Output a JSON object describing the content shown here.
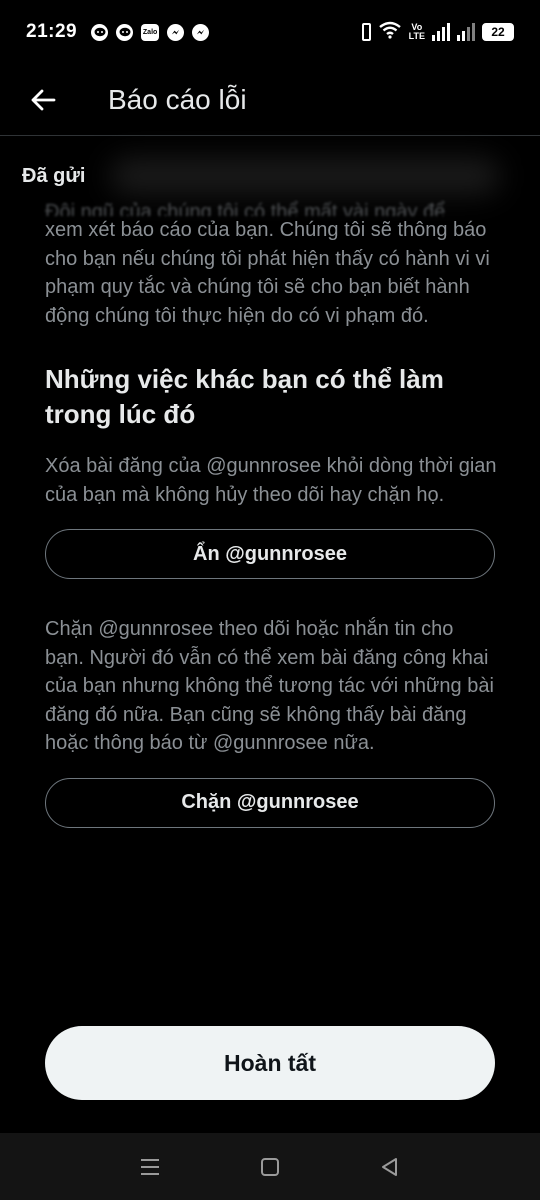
{
  "status_bar": {
    "time": "21:29",
    "notification_icons": [
      "discord-icon",
      "discord-icon",
      "zalo-icon",
      "messenger-icon",
      "messenger-icon"
    ],
    "zalo_text": "Zalo",
    "volte_line1": "Vo",
    "volte_line2": "LTE",
    "battery": "22"
  },
  "header": {
    "back_icon": "arrow-left-icon",
    "title": "Báo cáo lỗi"
  },
  "sent_label": "Đã gửi",
  "content": {
    "intro_fragment": "Đội ngũ của chúng tôi có thể mất vài ngày để",
    "intro": "xem xét báo cáo của bạn. Chúng tôi sẽ thông báo cho bạn nếu chúng tôi phát hiện thấy có hành vi vi phạm quy tắc và chúng tôi sẽ cho bạn biết hành động chúng tôi thực hiện do có vi phạm đó.",
    "section_title": "Những việc khác bạn có thể làm trong lúc đó",
    "mute_description": "Xóa bài đăng của @gunnrosee khỏi dòng thời gian của bạn mà không hủy theo dõi hay chặn họ.",
    "mute_button": "Ẩn @gunnrosee",
    "block_description": "Chặn @gunnrosee theo dõi hoặc nhắn tin cho bạn. Người đó vẫn có thể xem bài đăng công khai của bạn nhưng không thể tương tác với những bài đăng đó nữa. Bạn cũng sẽ không thấy bài đăng hoặc thông báo từ @gunnrosee nữa.",
    "block_button": "Chặn @gunnrosee"
  },
  "done_button": "Hoàn tất",
  "colors": {
    "background": "#000000",
    "text_primary": "#e7e9ea",
    "text_secondary": "#8b9095",
    "outline": "#6e767d",
    "done_button_bg": "#eff3f4"
  }
}
